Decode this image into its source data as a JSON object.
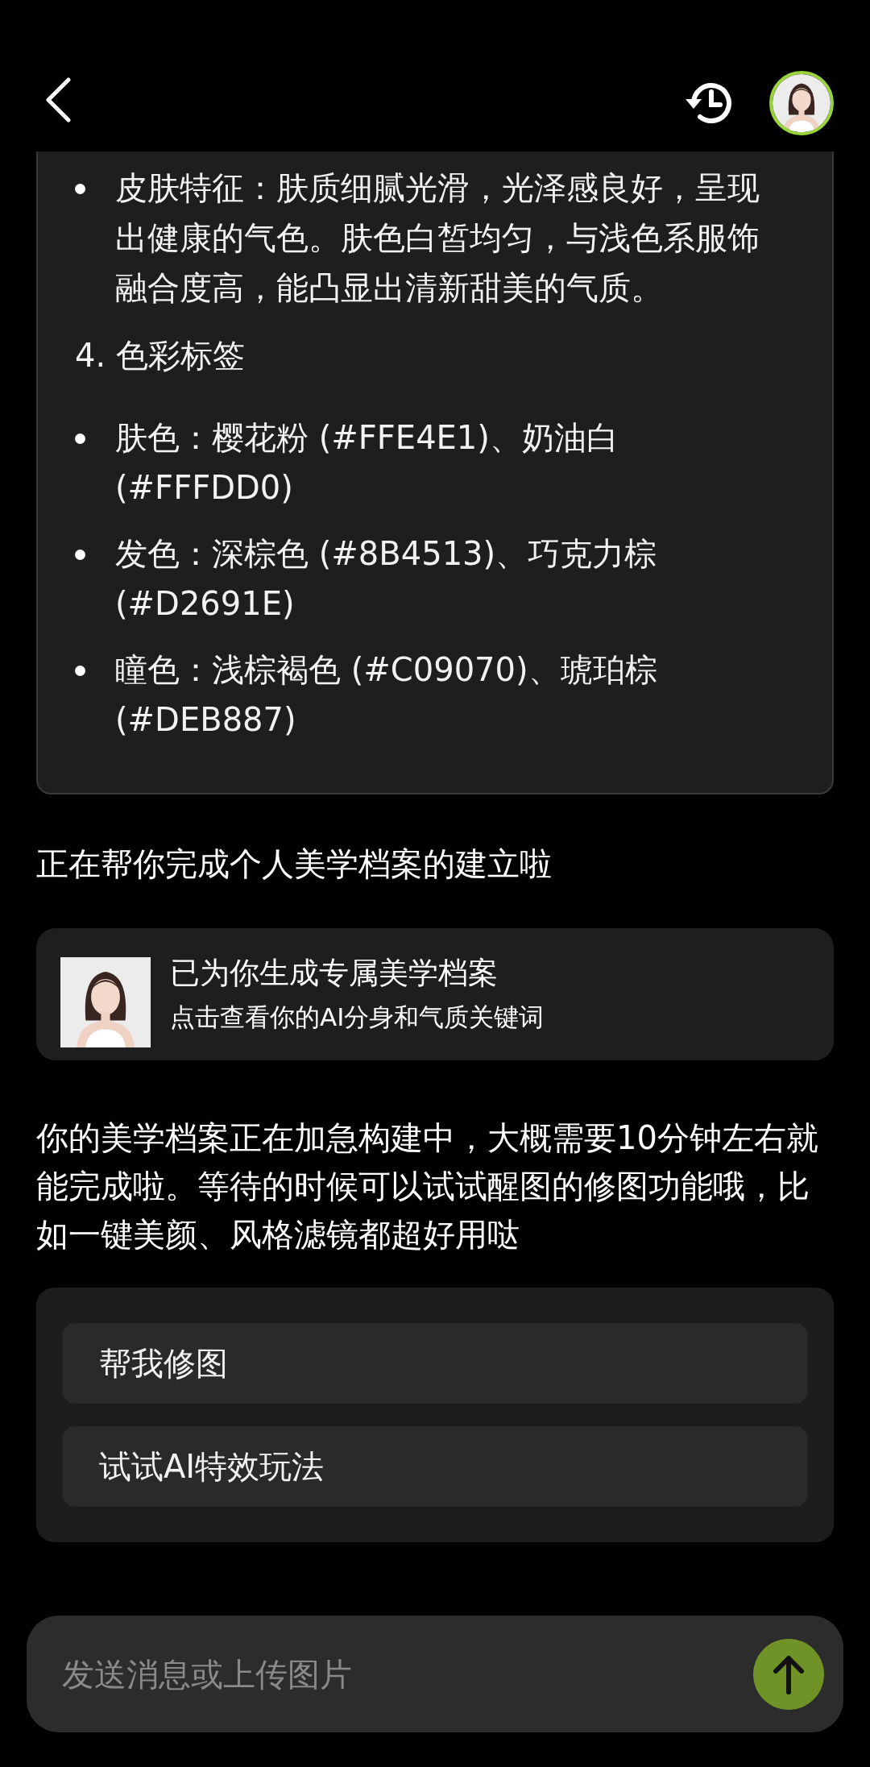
{
  "analysis_card": {
    "items": [
      {
        "kind": "bullet",
        "text": "皮肤特征：肤质细腻光滑，光泽感良好，呈现出健康的气色。肤色白皙均匀，与浅色系服饰融合度高，能凸显出清新甜美的气质。"
      },
      {
        "kind": "heading",
        "text": "4. 色彩标签"
      },
      {
        "kind": "bullet",
        "text": "肤色：樱花粉 (#FFE4E1)、奶油白 (#FFFDD0)"
      },
      {
        "kind": "bullet",
        "text": "发色：深棕色 (#8B4513)、巧克力棕 (#D2691E)"
      },
      {
        "kind": "bullet",
        "text": "瞳色：浅棕褐色 (#C09070)、琥珀棕 (#DEB887)"
      }
    ]
  },
  "message_1": "正在帮你完成个人美学档案的建立啦",
  "profile_card": {
    "title": "已为你生成专属美学档案",
    "subtitle": "点击查看你的AI分身和气质关键词"
  },
  "message_2": "你的美学档案正在加急构建中，大概需要10分钟左右就能完成啦。等待的时候可以试试醒图的修图功能哦，比如一键美颜、风格滤镜都超好用哒",
  "suggestions": [
    "帮我修图",
    "试试AI特效玩法"
  ],
  "input": {
    "placeholder": "发送消息或上传图片"
  }
}
